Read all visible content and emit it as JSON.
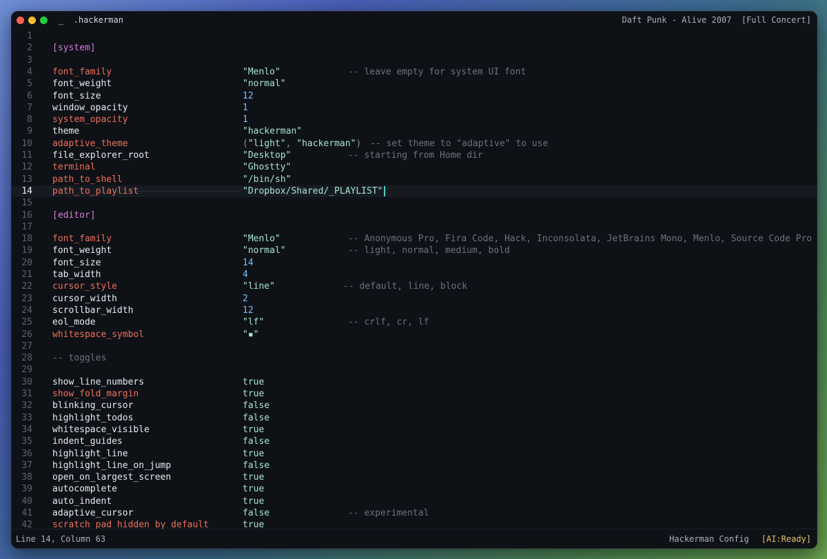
{
  "titlebar": {
    "left_title": "_  .hackerman",
    "right_title": "Daft Punk - Alive 2007  [Full Concert]"
  },
  "lines": [
    {
      "n": "1"
    },
    {
      "n": "2",
      "section": "[system]"
    },
    {
      "n": "3"
    },
    {
      "n": "4",
      "key": "font_family",
      "red": true,
      "val": "\"Menlo\"",
      "type": "str",
      "comment": "-- leave empty for system UI font",
      "cpos": 488
    },
    {
      "n": "5",
      "key": "font_weight",
      "val": "\"normal\"",
      "type": "str"
    },
    {
      "n": "6",
      "key": "font_size",
      "val": "12",
      "type": "num"
    },
    {
      "n": "7",
      "key": "window_opacity",
      "val": "1",
      "type": "num"
    },
    {
      "n": "8",
      "key": "system_opacity",
      "red": true,
      "val": "1",
      "type": "num"
    },
    {
      "n": "9",
      "key": "theme",
      "val": "\"hackerman\"",
      "type": "str"
    },
    {
      "n": "10",
      "key": "adaptive_theme",
      "red": true,
      "val": "(\"light\", \"hackerman\")",
      "type": "tuple",
      "comment": "-- set theme to \"adaptive\" to use",
      "cpos": 520
    },
    {
      "n": "11",
      "key": "file_explorer_root",
      "val": "\"Desktop\"",
      "type": "str",
      "comment": "-- starting from Home dir",
      "cpos": 488
    },
    {
      "n": "12",
      "key": "terminal",
      "red": true,
      "val": "\"Ghostty\"",
      "type": "str"
    },
    {
      "n": "13",
      "key": "path_to_shell",
      "red": true,
      "val": "\"/bin/sh\"",
      "type": "str"
    },
    {
      "n": "14",
      "key": "path_to_playlist",
      "red": true,
      "val": "\"Dropbox/Shared/_PLAYLIST\"",
      "type": "str",
      "current": true
    },
    {
      "n": "15"
    },
    {
      "n": "16",
      "section": "[editor]"
    },
    {
      "n": "17"
    },
    {
      "n": "18",
      "key": "font_family",
      "red": true,
      "val": "\"Menlo\"",
      "type": "str",
      "comment": "-- Anonymous Pro, Fira Code, Hack, Inconsolata, JetBrains Mono, Menlo, Source Code Pro",
      "cpos": 488
    },
    {
      "n": "19",
      "key": "font_weight",
      "val": "\"normal\"",
      "type": "str",
      "comment": "-- light, normal, medium, bold",
      "cpos": 488
    },
    {
      "n": "20",
      "key": "font_size",
      "val": "14",
      "type": "num"
    },
    {
      "n": "21",
      "key": "tab_width",
      "val": "4",
      "type": "num"
    },
    {
      "n": "22",
      "key": "cursor_style",
      "red": true,
      "val": "\"line\"",
      "type": "str",
      "comment": "-- default, line, block",
      "cpos": 481
    },
    {
      "n": "23",
      "key": "cursor_width",
      "val": "2",
      "type": "num"
    },
    {
      "n": "24",
      "key": "scrollbar_width",
      "val": "12",
      "type": "num"
    },
    {
      "n": "25",
      "key": "eol_mode",
      "val": "\"lf\"",
      "type": "str",
      "comment": "-- crlf, cr, lf",
      "cpos": 488
    },
    {
      "n": "26",
      "key": "whitespace_symbol",
      "red": true,
      "val": "\"▪\"",
      "type": "str"
    },
    {
      "n": "27"
    },
    {
      "n": "28",
      "plaincomment": "-- toggles"
    },
    {
      "n": "29"
    },
    {
      "n": "30",
      "key": "show_line_numbers",
      "val": "true",
      "type": "bool"
    },
    {
      "n": "31",
      "key": "show_fold_margin",
      "red": true,
      "val": "true",
      "type": "bool"
    },
    {
      "n": "32",
      "key": "blinking_cursor",
      "val": "false",
      "type": "bool"
    },
    {
      "n": "33",
      "key": "highlight_todos",
      "val": "false",
      "type": "bool"
    },
    {
      "n": "34",
      "key": "whitespace_visible",
      "val": "true",
      "type": "bool"
    },
    {
      "n": "35",
      "key": "indent_guides",
      "val": "false",
      "type": "bool"
    },
    {
      "n": "36",
      "key": "highlight_line",
      "val": "true",
      "type": "bool"
    },
    {
      "n": "37",
      "key": "highlight_line_on_jump",
      "val": "false",
      "type": "bool"
    },
    {
      "n": "38",
      "key": "open_on_largest_screen",
      "val": "true",
      "type": "bool"
    },
    {
      "n": "39",
      "key": "autocomplete",
      "val": "true",
      "type": "bool"
    },
    {
      "n": "40",
      "key": "auto_indent",
      "val": "true",
      "type": "bool"
    },
    {
      "n": "41",
      "key": "adaptive_cursor",
      "val": "false",
      "type": "bool",
      "comment": "-- experimental",
      "cpos": 488
    },
    {
      "n": "42",
      "key": "scratch_pad_hidden_by_default",
      "red": true,
      "val": "true",
      "type": "bool"
    }
  ],
  "status": {
    "position": "Line 14, Column 63",
    "config_name": "Hackerman Config",
    "ai_status": "[AI:Ready]"
  },
  "colors": {
    "background": "#0e1116",
    "key_red": "#f0705a",
    "section": "#d57bdc",
    "string": "#a8e6cf",
    "number": "#79c0ff",
    "comment": "#6b7480"
  }
}
